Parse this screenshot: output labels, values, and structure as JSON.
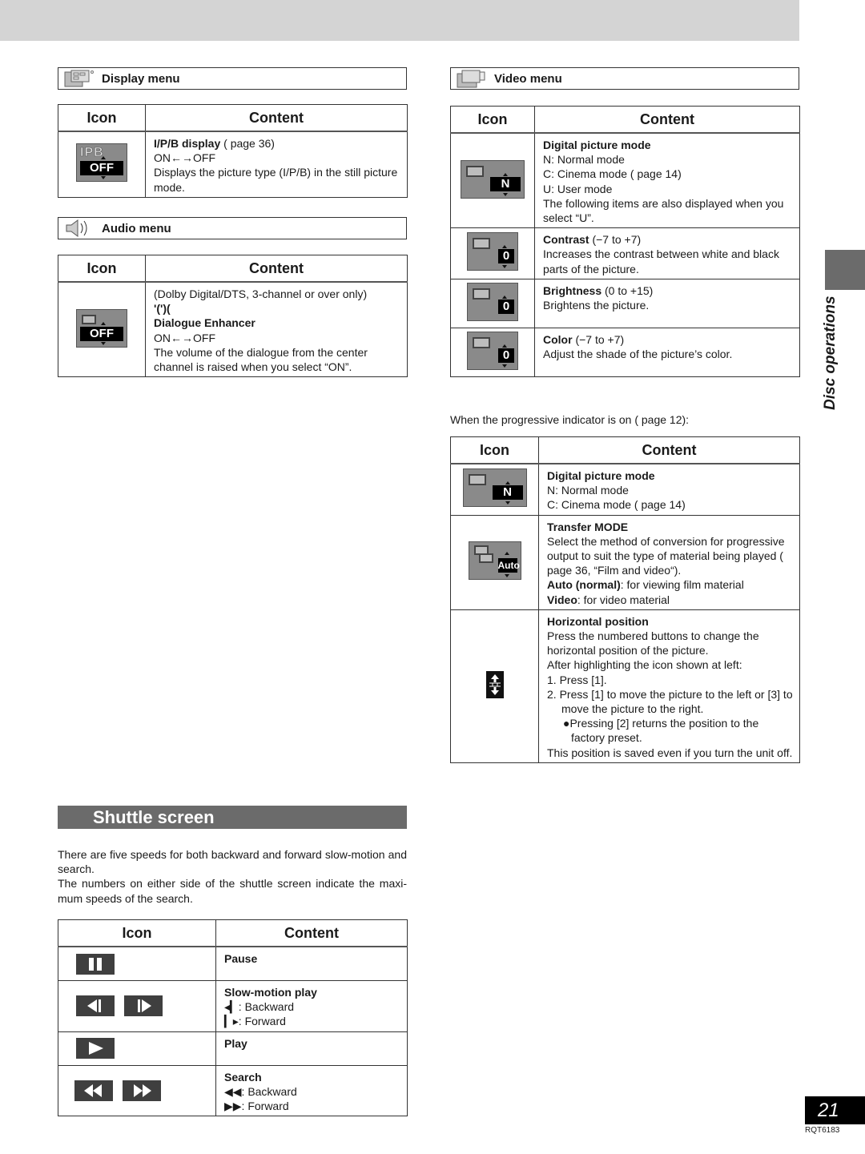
{
  "display_menu": {
    "title": "Display menu",
    "icon": "display-screens-icon",
    "header": {
      "icon": "Icon",
      "content": "Content"
    },
    "rows": [
      {
        "icon": "ipb-osd-icon",
        "osd_label": "IPB",
        "osd_value": "OFF",
        "title": "I/P/B display",
        "title_suffix": " (    page 36)",
        "lines": [
          "ON←→OFF",
          "Displays the picture type (I/P/B) in the still picture mode."
        ]
      }
    ]
  },
  "audio_menu": {
    "title": "Audio menu",
    "icon": "speaker-icon",
    "header": {
      "icon": "Icon",
      "content": "Content"
    },
    "rows": [
      {
        "icon": "dialogue-enhancer-osd-icon",
        "osd_value": "OFF",
        "pre": "(Dolby Digital/DTS, 3-channel or over only)",
        "pre2": " '(')(",
        "title": "Dialogue Enhancer",
        "lines": [
          "ON←→OFF",
          "The volume of the dialogue from the center channel is raised when you select “ON”."
        ]
      }
    ]
  },
  "video_menu": {
    "title": "Video menu",
    "icon": "video-screens-icon",
    "header": {
      "icon": "Icon",
      "content": "Content"
    },
    "rows": [
      {
        "icon": "picture-mode-osd-icon",
        "osd_value": "N",
        "title": "Digital picture mode",
        "title_suffix": "",
        "lines": [
          "N: Normal mode",
          "C: Cinema mode (    page 14)",
          "U: User mode",
          "The following items are also displayed when you select “U”."
        ]
      },
      {
        "icon": "contrast-osd-icon",
        "osd_value": "0",
        "title": "Contrast",
        "title_suffix": " (−7 to +7)",
        "lines": [
          "Increases the contrast between white and black parts of the picture."
        ]
      },
      {
        "icon": "brightness-osd-icon",
        "osd_value": "0",
        "title": "Brightness",
        "title_suffix": " (0 to +15)",
        "lines": [
          "Brightens the picture."
        ]
      },
      {
        "icon": "color-osd-icon",
        "osd_value": "0",
        "title": "Color",
        "title_suffix": " (−7 to +7)",
        "lines": [
          "Adjust the shade of the picture’s color."
        ]
      }
    ]
  },
  "progressive": {
    "note": "When the progressive indicator is on (    page 12):",
    "header": {
      "icon": "Icon",
      "content": "Content"
    },
    "rows": [
      {
        "icon": "picture-mode-osd-icon",
        "osd_value": "N",
        "title": "Digital picture mode",
        "lines": [
          "N: Normal mode",
          "C: Cinema mode (    page 14)"
        ]
      },
      {
        "icon": "transfer-mode-osd-icon",
        "osd_value": "Auto",
        "title": "Transfer MODE",
        "lines": [
          "Select the method of conversion for progressive output to suit the type of material being played (    page 36, “Film and video“)."
        ],
        "auto_label": "Auto (normal)",
        "auto_text": ": for viewing film material",
        "video_label": "Video",
        "video_text": ": for video material"
      },
      {
        "icon": "horizontal-position-icon",
        "title": "Horizontal position",
        "lines": [
          "Press the numbered buttons to change the horizontal position of the picture.",
          "After highlighting the icon shown at left:"
        ],
        "steps": [
          "1.  Press [1].",
          "2.  Press [1] to move the picture to the left or [3] to move the picture to the right."
        ],
        "bullet": "●Pressing [2] returns the position to the factory preset.",
        "footer": "This position is saved even if you turn the unit off."
      }
    ]
  },
  "shuttle": {
    "title": "Shuttle screen",
    "paragraphs": [
      "There are five speeds for both backward and forward slow-motion and search.",
      "The numbers on either side of the shuttle screen indicate the maxi-mum speeds of the search."
    ],
    "header": {
      "icon": "Icon",
      "content": "Content"
    },
    "rows": [
      {
        "icons": [
          "pause-icon"
        ],
        "title": "Pause",
        "lines": []
      },
      {
        "icons": [
          "slow-backward-icon",
          "slow-forward-icon"
        ],
        "title": "Slow-motion play",
        "lines": [
          "◂▎: Backward",
          "▎▸: Forward"
        ]
      },
      {
        "icons": [
          "play-icon"
        ],
        "title": "Play",
        "lines": []
      },
      {
        "icons": [
          "rewind-icon",
          "fast-forward-icon"
        ],
        "title": "Search",
        "lines": [
          "◀◀: Backward",
          "▶▶: Forward"
        ]
      }
    ]
  },
  "side": {
    "section": "Disc operations"
  },
  "footer": {
    "page": "21",
    "doc_id": "RQT6183"
  }
}
